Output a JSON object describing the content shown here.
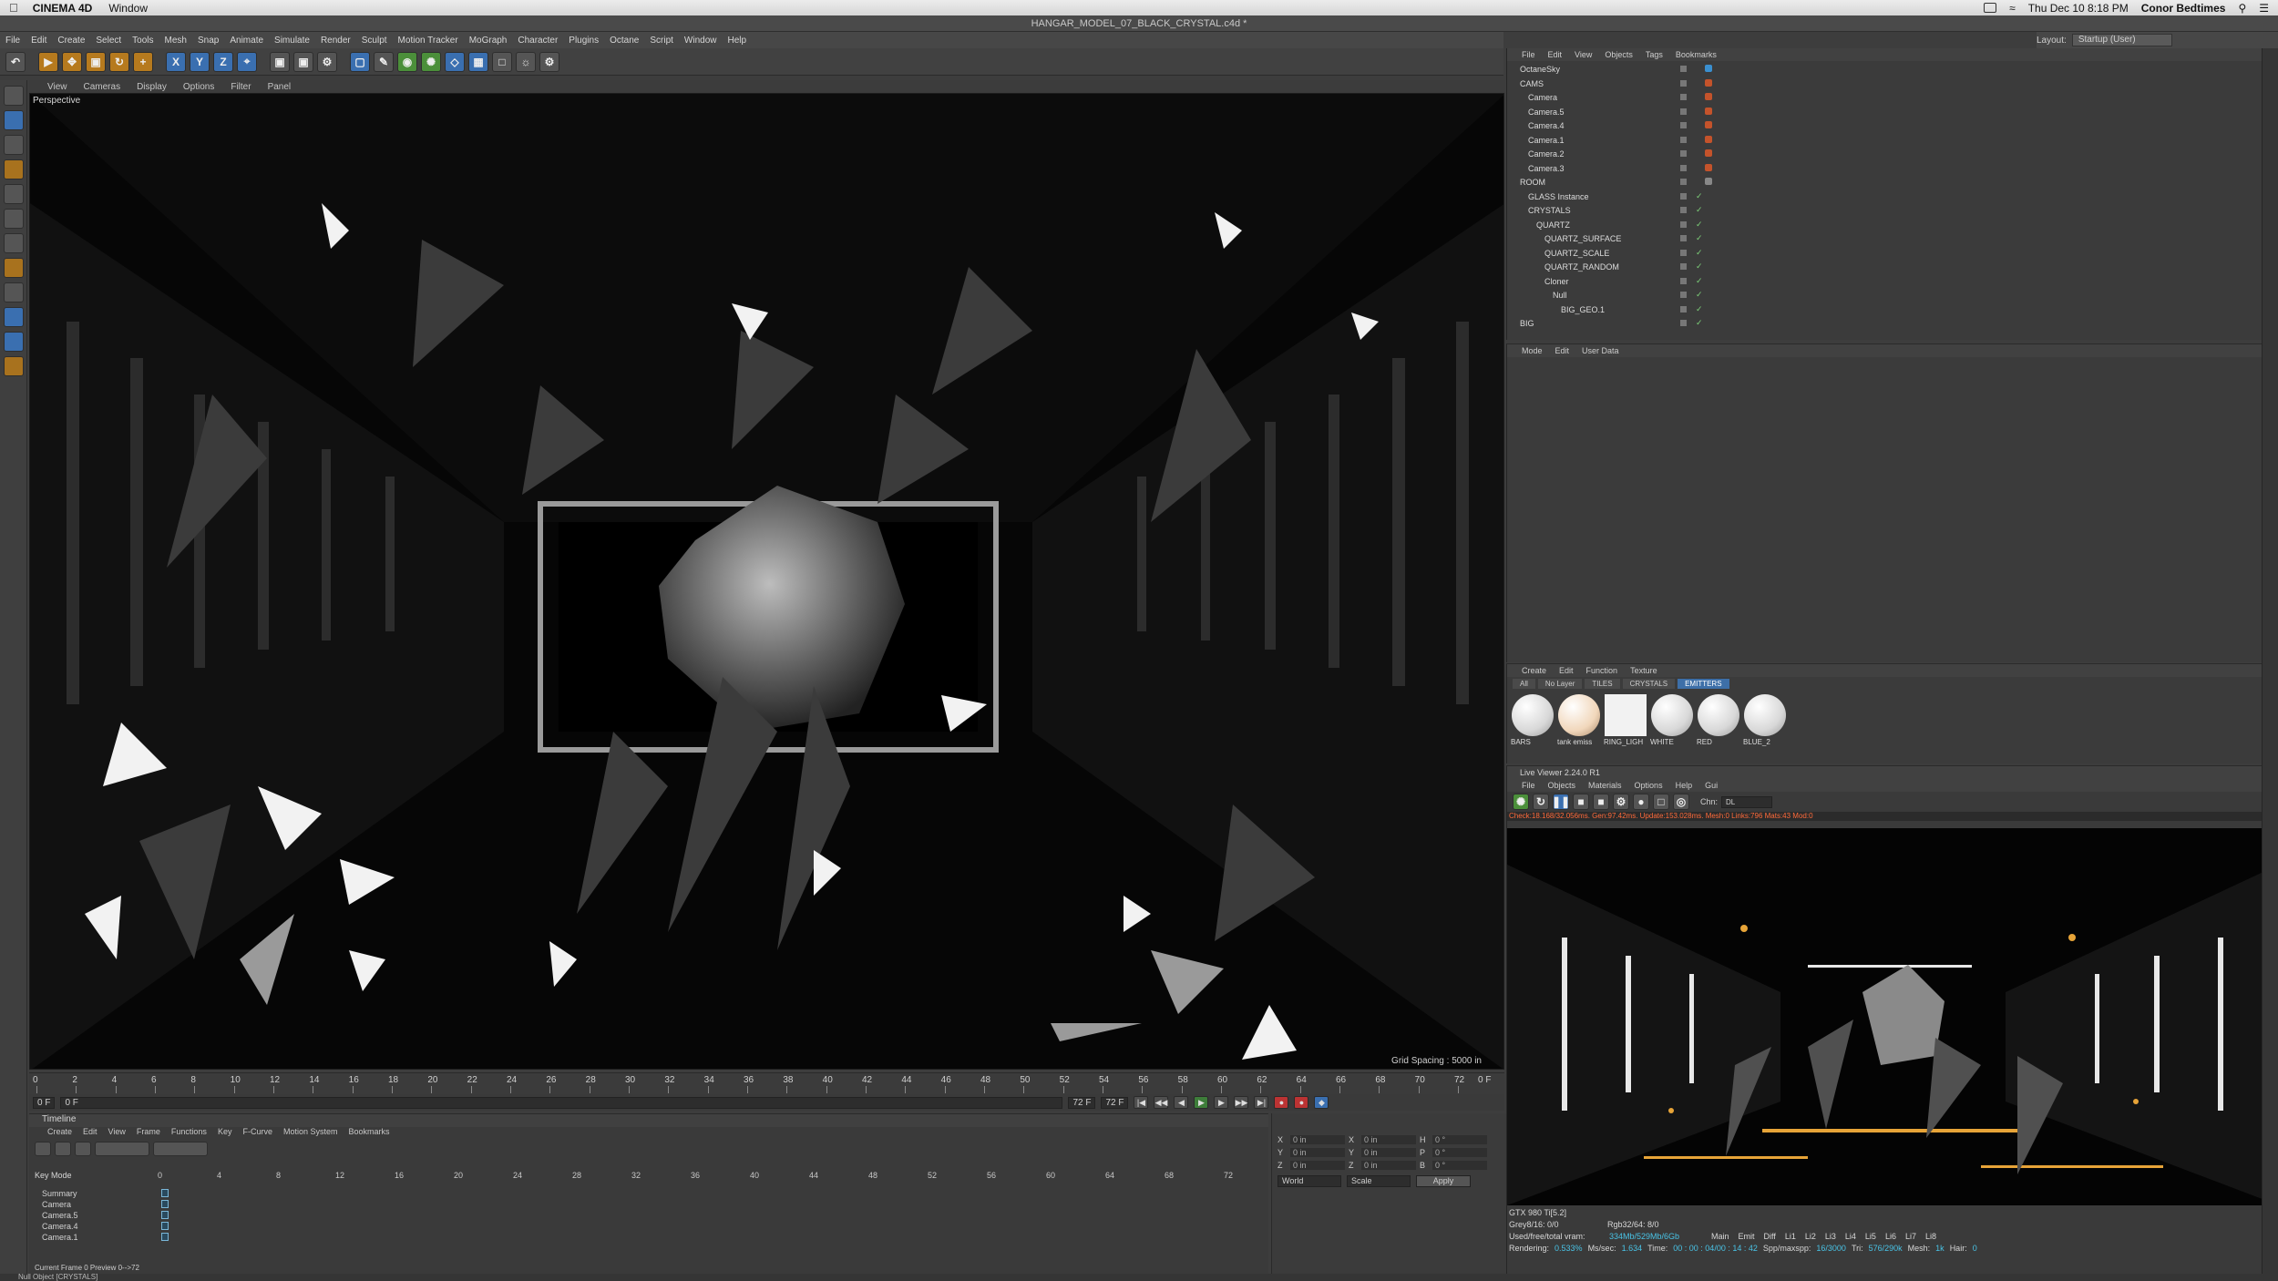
{
  "mac": {
    "app_name": "CINEMA 4D",
    "menu": [
      "Window"
    ],
    "clock": "Thu Dec 10  8:18 PM",
    "user": "Conor Bedtimes"
  },
  "window_title": "HANGAR_MODEL_07_BLACK_CRYSTAL.c4d *",
  "main_menu": [
    "File",
    "Edit",
    "Create",
    "Select",
    "Tools",
    "Mesh",
    "Snap",
    "Animate",
    "Simulate",
    "Render",
    "Sculpt",
    "Motion Tracker",
    "MoGraph",
    "Character",
    "Plugins",
    "Octane",
    "Script",
    "Window",
    "Help"
  ],
  "layout": {
    "label": "Layout:",
    "value": "Startup (User)"
  },
  "toolbar_axes": [
    "X",
    "Y",
    "Z"
  ],
  "viewport": {
    "menu": [
      "View",
      "Cameras",
      "Display",
      "Options",
      "Filter",
      "Panel"
    ],
    "label": "Perspective",
    "grid_spacing": "Grid Spacing : 5000 in"
  },
  "ruler_ticks": [
    "0",
    "2",
    "4",
    "6",
    "8",
    "10",
    "12",
    "14",
    "16",
    "18",
    "20",
    "22",
    "24",
    "26",
    "28",
    "30",
    "32",
    "34",
    "36",
    "38",
    "40",
    "42",
    "44",
    "46",
    "48",
    "50",
    "52",
    "54",
    "56",
    "58",
    "60",
    "62",
    "64",
    "66",
    "68",
    "70",
    "72"
  ],
  "ruler_end": "0 F",
  "playback": {
    "start": "0 F",
    "field2": "0 F",
    "end1": "72 F",
    "end2": "72 F"
  },
  "timeline": {
    "title": "Timeline",
    "menu": [
      "Create",
      "Edit",
      "View",
      "Frame",
      "Functions",
      "Key",
      "F-Curve",
      "Motion System",
      "Bookmarks"
    ],
    "mode": "Key Mode",
    "ticks": [
      "0",
      "4",
      "8",
      "12",
      "16",
      "20",
      "24",
      "28",
      "32",
      "36",
      "40",
      "44",
      "48",
      "52",
      "56",
      "60",
      "64",
      "68",
      "72"
    ],
    "tracks": [
      "Summary",
      "Camera",
      "Camera.5",
      "Camera.4",
      "Camera.1"
    ],
    "footer": "Current Frame  0  Preview  0-->72"
  },
  "coords": {
    "rows": [
      [
        "X",
        "0 in",
        "X",
        "0 in",
        "H",
        "0 °"
      ],
      [
        "Y",
        "0 in",
        "Y",
        "0 in",
        "P",
        "0 °"
      ],
      [
        "Z",
        "0 in",
        "Z",
        "0 in",
        "B",
        "0 °"
      ]
    ],
    "world": "World",
    "scale": "Scale",
    "apply": "Apply"
  },
  "status": "Null Object [CRYSTALS]",
  "object_manager": {
    "menu": [
      "File",
      "Edit",
      "View",
      "Objects",
      "Tags",
      "Bookmarks"
    ],
    "objects": [
      {
        "name": "OctaneSky",
        "indent": 0
      },
      {
        "name": "CAMS",
        "indent": 0
      },
      {
        "name": "Camera",
        "indent": 1
      },
      {
        "name": "Camera.5",
        "indent": 1
      },
      {
        "name": "Camera.4",
        "indent": 1
      },
      {
        "name": "Camera.1",
        "indent": 1
      },
      {
        "name": "Camera.2",
        "indent": 1
      },
      {
        "name": "Camera.3",
        "indent": 1
      },
      {
        "name": "ROOM",
        "indent": 0
      },
      {
        "name": "GLASS Instance",
        "indent": 1
      },
      {
        "name": "CRYSTALS",
        "indent": 1
      },
      {
        "name": "QUARTZ",
        "indent": 2
      },
      {
        "name": "QUARTZ_SURFACE",
        "indent": 3
      },
      {
        "name": "QUARTZ_SCALE",
        "indent": 3
      },
      {
        "name": "QUARTZ_RANDOM",
        "indent": 3
      },
      {
        "name": "Cloner",
        "indent": 3
      },
      {
        "name": "Null",
        "indent": 4
      },
      {
        "name": "BIG_GEO.1",
        "indent": 5
      },
      {
        "name": "BIG",
        "indent": 0
      }
    ]
  },
  "attribute_manager": {
    "menu": [
      "Mode",
      "Edit",
      "User Data"
    ]
  },
  "material_manager": {
    "menu": [
      "Create",
      "Edit",
      "Function",
      "Texture"
    ],
    "tabs": [
      "All",
      "No Layer",
      "TILES",
      "CRYSTALS",
      "EMITTERS"
    ],
    "active_tab": "EMITTERS",
    "materials": [
      "BARS",
      "tank emiss",
      "RING_LIGH",
      "WHITE",
      "RED",
      "BLUE_2"
    ]
  },
  "live_viewer": {
    "title": "Live Viewer 2.24.0 R1",
    "menu": [
      "File",
      "Objects",
      "Materials",
      "Options",
      "Help",
      "Gui"
    ],
    "channel_label": "Chn:",
    "channel_value": "DL",
    "info": "Check:18.168/32.056ms. Gen:97.42ms. Update:153.028ms. Mesh:0 Links:796 Mats:43 Mod:0",
    "gpu": "GTX 980 Ti[5.2]",
    "grey": "Grey8/16: 0/0",
    "rgb": "Rgb32/64: 8/0",
    "vram_label": "Used/free/total vram:",
    "vram": "334Mb/529Mb/6Gb",
    "rendering_label": "Rendering:",
    "rendering": "0.533%",
    "mssec_label": "Ms/sec:",
    "mssec": "1.634",
    "time_label": "Time:",
    "time": "00 : 00 : 04/00 : 14 : 42",
    "spp_label": "Spp/maxspp:",
    "spp": "16/3000",
    "tri_label": "Tri:",
    "tri": "576/290k",
    "mesh_label": "Mesh:",
    "mesh": "1k",
    "hair_label": "Hair:",
    "hair": "0",
    "passes": [
      "Main",
      "Emit",
      "Diff",
      "Li1",
      "Li2",
      "Li3",
      "Li4",
      "Li5",
      "Li6",
      "Li7",
      "Li8"
    ]
  }
}
